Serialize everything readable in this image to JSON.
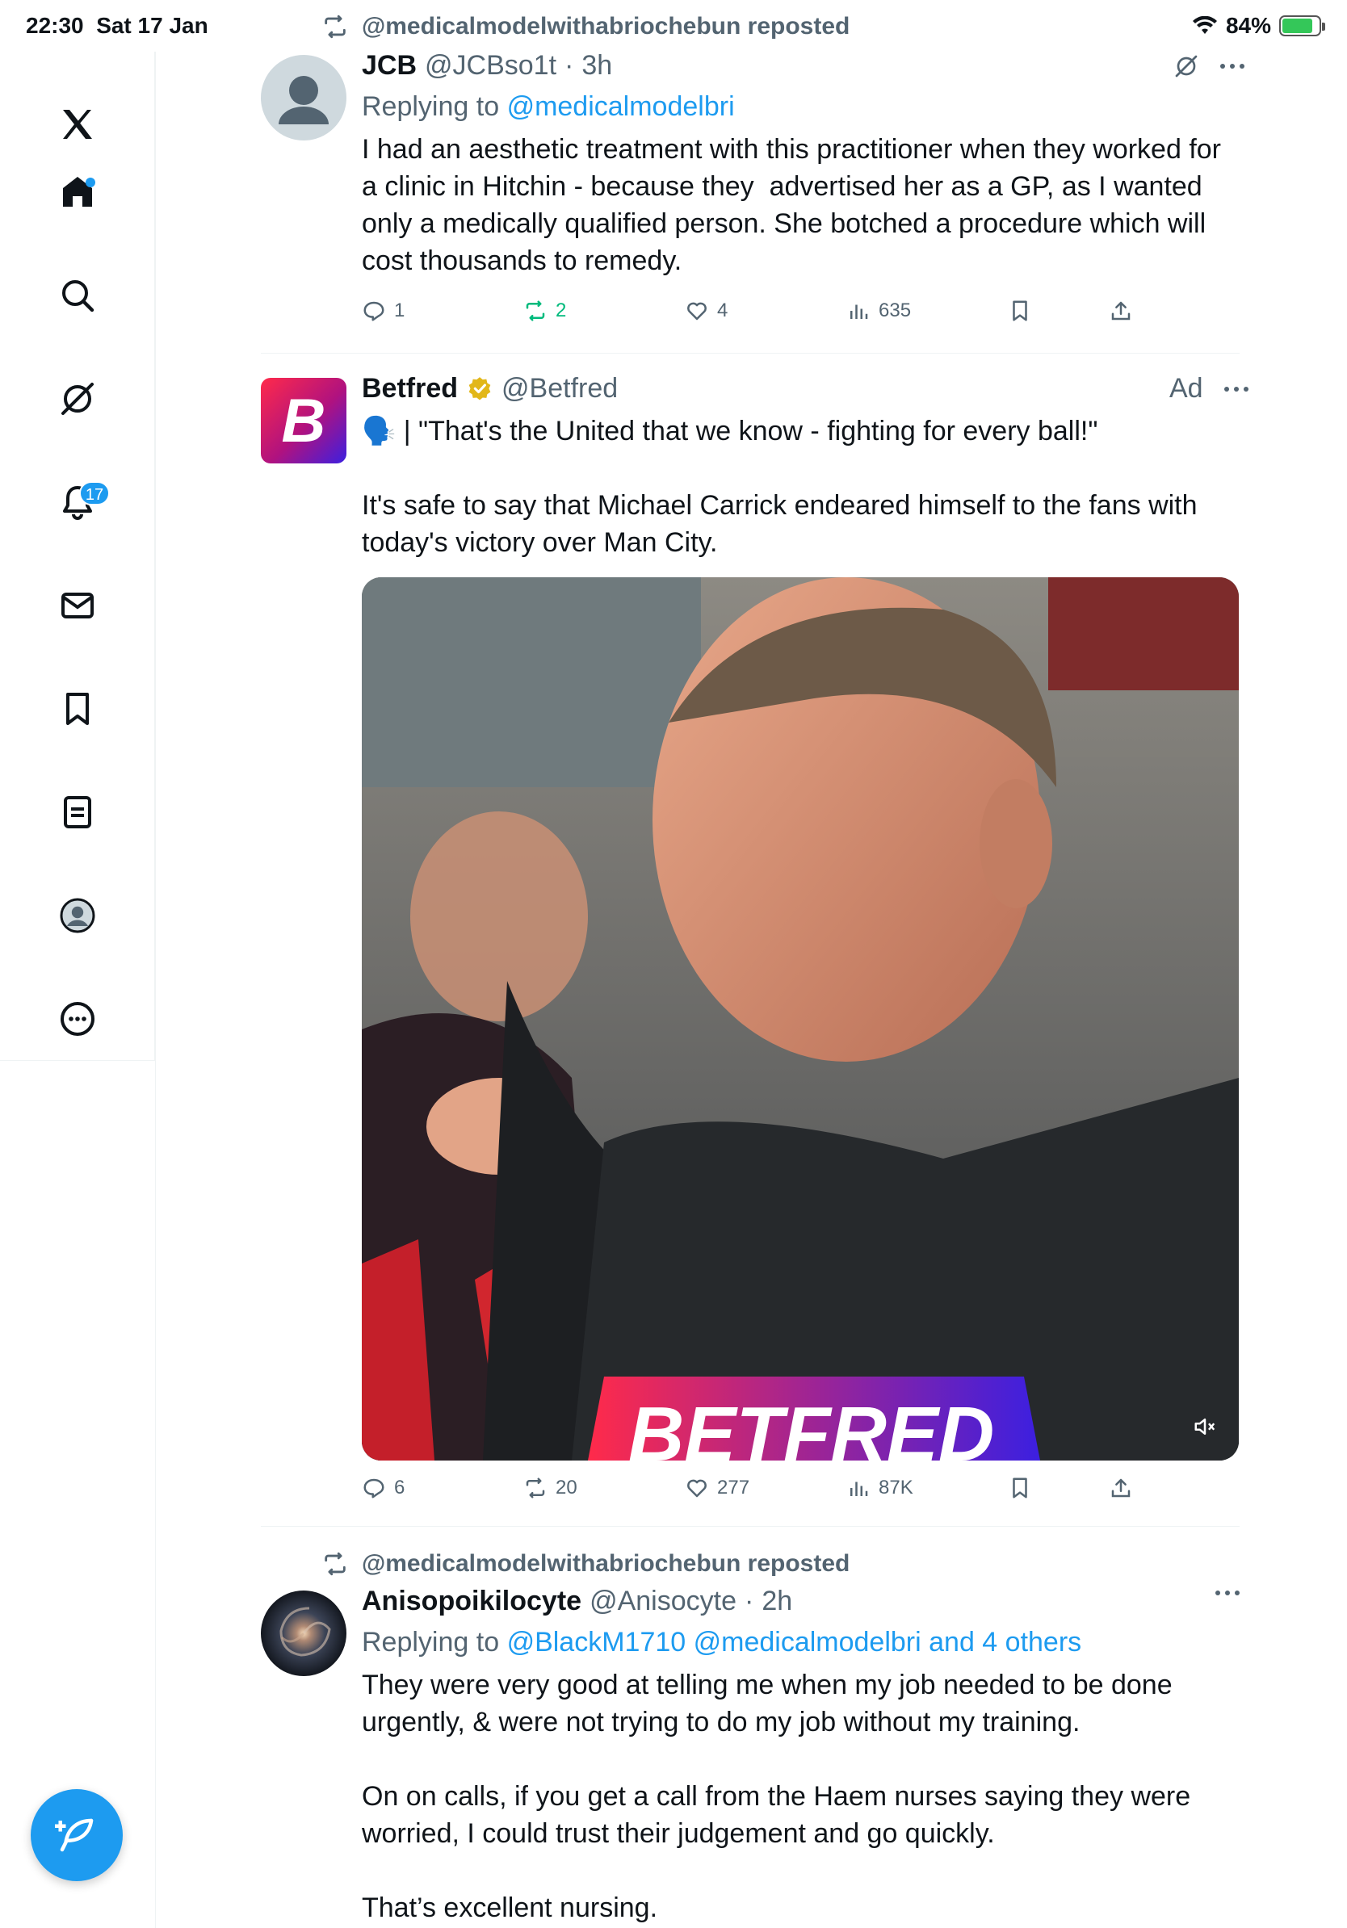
{
  "status_bar": {
    "time": "22:30",
    "date": "Sat 17 Jan",
    "battery": "84%",
    "battery_level": 0.84
  },
  "sidebar": {
    "notifications_count": "17",
    "items": [
      "home-icon",
      "search-icon",
      "grok-icon",
      "notifications-icon",
      "messages-icon",
      "bookmarks-icon",
      "lists-icon",
      "profile-icon",
      "more-icon"
    ]
  },
  "tweets": [
    {
      "repost_label": "@medicalmodelwithabriochebun reposted",
      "name": "JCB",
      "handle": "@JCBso1t",
      "sep": "·",
      "time": "3h",
      "replying_prefix": "Replying to",
      "replying_to": "@medicalmodelbri",
      "text": "I had an aesthetic treatment with this practitioner when they worked for a clinic in Hitchin - because they  advertised her as a GP, as I wanted only a medically qualified person. She botched a procedure which will cost thousands to remedy.",
      "replies": "1",
      "reposts": "2",
      "likes": "4",
      "views": "635"
    },
    {
      "name": "Betfred",
      "handle": "@Betfred",
      "ad_label": "Ad",
      "avatar_letter": "B",
      "text": "🗣️ | \"That's the United that we know - fighting for every ball!\"\n\nIt's safe to say that Michael Carrick endeared himself to the fans with today's victory over Man City.",
      "media_banner": "BETFRED",
      "replies": "6",
      "reposts": "20",
      "likes": "277",
      "views": "87K"
    },
    {
      "repost_label": "@medicalmodelwithabriochebun reposted",
      "name": "Anisopoikilocyte",
      "handle": "@Anisocyte",
      "sep": "·",
      "time": "2h",
      "replying_prefix": "Replying to",
      "replying_to": "@BlackM1710 @medicalmodelbri and 4 others",
      "text": "They were very good at telling me when my job needed to be done urgently, & were not trying to do my job without my training.\n\nOn on calls, if you get a call from the Haem nurses saying they were worried, I could trust their judgement and go quickly.\n\nThat’s excellent nursing."
    }
  ],
  "colors": {
    "accent": "#1d9bf0",
    "repost_green": "#00ba7c",
    "muted": "#536471",
    "verified_gold": "#e2b719"
  }
}
